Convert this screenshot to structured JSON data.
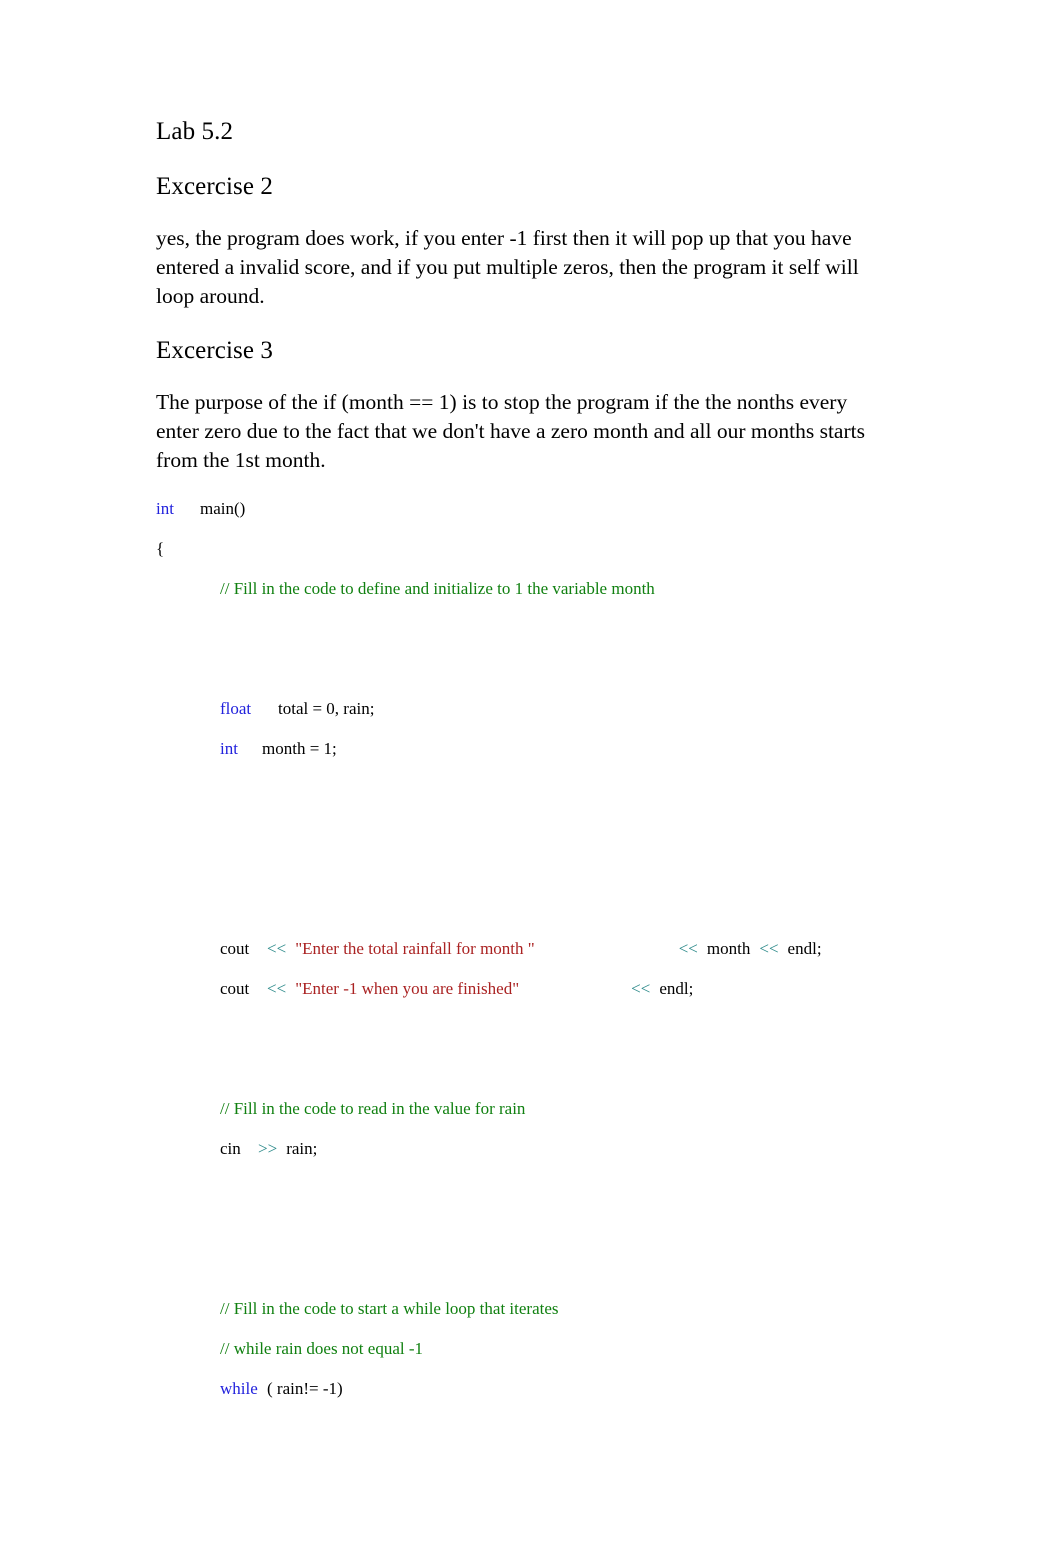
{
  "document": {
    "title": "Lab 5.2",
    "sections": [
      {
        "heading": "Excercise 2",
        "paragraph": "yes, the program does work, if you enter -1 first then it will pop up that you have entered a invalid score, and if you put multiple zeros, then the program it self will loop around."
      },
      {
        "heading": "Excercise 3",
        "paragraph": "The purpose of the if (month == 1) is to stop the program if the the nonths every enter zero due to the fact that we don't have a zero month and all our months starts from the 1st month."
      }
    ]
  },
  "code": {
    "line_int_keyword": "int",
    "line_main": "main()",
    "line_open_brace": "{",
    "comment_define_month": "// Fill in the code to define and initialize to 1 the variable month",
    "float_keyword": "float",
    "float_decl": "total = 0, rain;",
    "int_keyword": "int",
    "int_decl": "month = 1;",
    "cout1_name": "cout",
    "cout1_op1": "<<",
    "cout1_string": "\"Enter the total rainfall for month \"",
    "cout1_op2": "<<",
    "cout1_var": "month",
    "cout1_op3": "<<",
    "cout1_endl": "endl;",
    "cout2_name": "cout",
    "cout2_op1": "<<",
    "cout2_string": "\"Enter -1 when you are finished\"",
    "cout2_op2": "<<",
    "cout2_endl": "endl;",
    "comment_read_rain": "// Fill in the code to read in the value for rain",
    "cin_name": "cin",
    "cin_op": ">>",
    "cin_var": "rain;",
    "comment_while_loop": "// Fill in the code to start a while loop that iterates",
    "comment_while_cond": "// while rain does not equal -1",
    "while_keyword": "while",
    "while_condition": "( rain!= -1)"
  },
  "colors": {
    "keyword": "#2222dd",
    "comment": "#108010",
    "string": "#aa2222",
    "operator": "#2e8b8b",
    "text": "#000000",
    "background": "#ffffff"
  }
}
